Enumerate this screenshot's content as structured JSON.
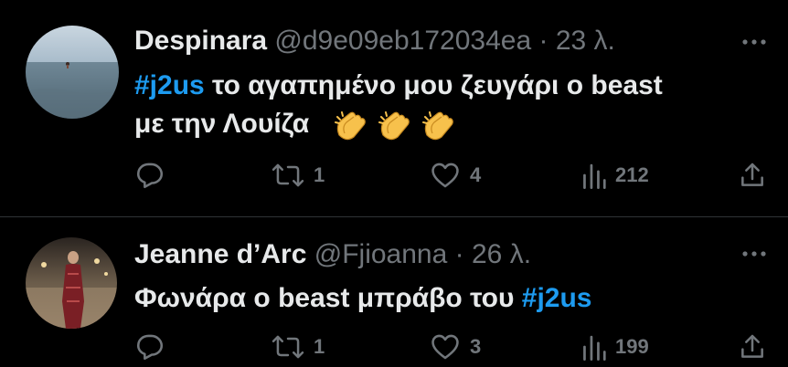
{
  "tweets": [
    {
      "name": "Despinara",
      "handle": "@d9e09eb172034ea",
      "dot": "·",
      "time": "23 λ.",
      "line1_hashtag": "#j2us",
      "line1_text": " το αγαπημένο μου ζευγάρι ο beast",
      "line2_text": "με την Λουίζα",
      "emojis": [
        "clapping-hands",
        "clapping-hands",
        "clapping-hands"
      ],
      "retweets": "1",
      "likes": "4",
      "views": "212"
    },
    {
      "name": "Jeanne d’Arc",
      "handle": "@Fjioanna",
      "dot": "·",
      "time": "26 λ.",
      "line1_text": "Φωνάρα ο beast μπράβο του ",
      "line1_hashtag": "#j2us",
      "retweets": "1",
      "likes": "3",
      "views": "199"
    }
  ],
  "colors": {
    "background": "#000000",
    "text": "#e7e9ea",
    "secondary": "#71767b",
    "accent": "#1d9bf0",
    "divider": "#2f3336"
  }
}
